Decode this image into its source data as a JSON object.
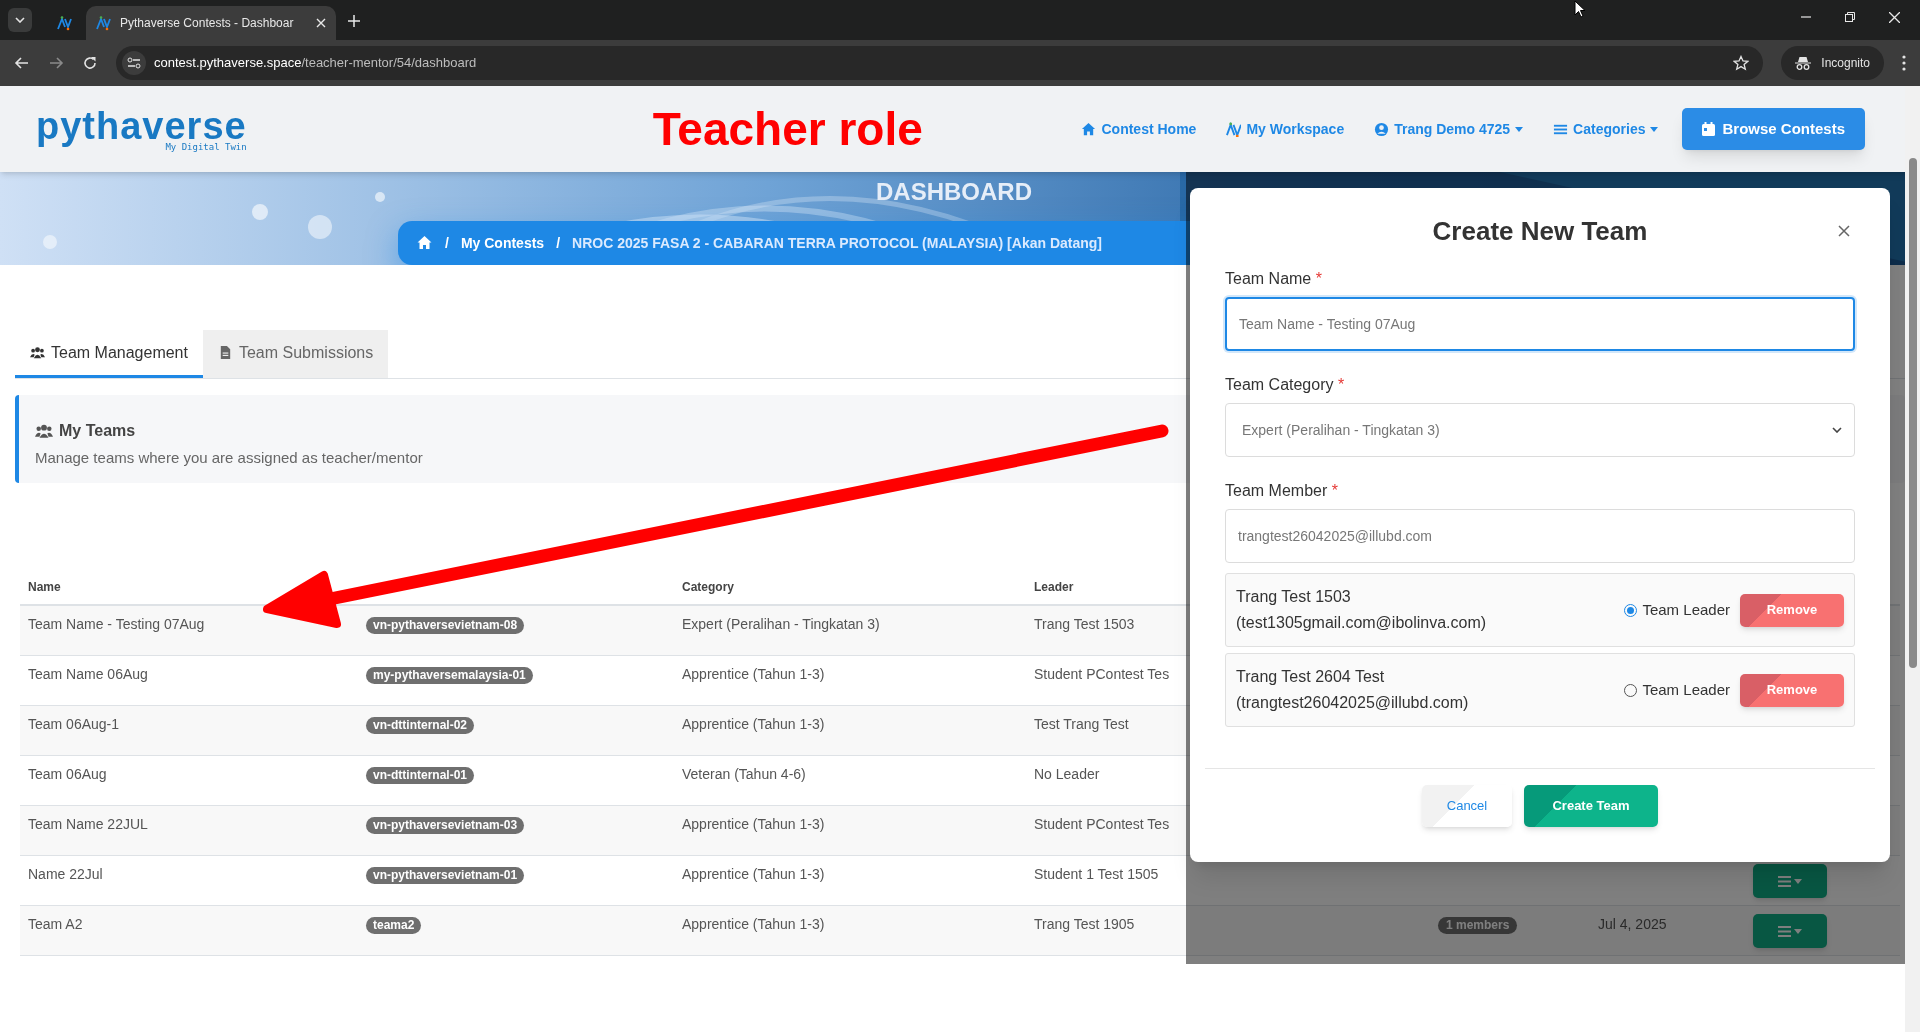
{
  "browser": {
    "tabs": [
      {
        "selected": false
      },
      {
        "title": "Pythaverse Contests - Dashboar",
        "selected": true
      }
    ],
    "url_host": "contest.pythaverse.space",
    "url_path": "/teacher-mentor/54/dashboard",
    "profile": "Incognito"
  },
  "header": {
    "logo": "pythaverse",
    "tagline": "My Digital Twin",
    "annotation": "Teacher role",
    "nav": [
      {
        "label": "Contest Home",
        "dropdown": false
      },
      {
        "label": "My Workspace",
        "dropdown": false
      },
      {
        "label": "Trang Demo 4725",
        "dropdown": true
      },
      {
        "label": "Categories",
        "dropdown": true
      }
    ],
    "cta": "Browse Contests"
  },
  "banner": {
    "title": "DASHBOARD",
    "breadcrumb": [
      {
        "separator": "/",
        "label": "My Contests"
      },
      {
        "separator": "/",
        "label": "NROC 2025 FASA 2 - CABARAN TERRA PROTOCOL (MALAYSIA) [Akan Datang]"
      }
    ]
  },
  "page_tabs": [
    {
      "label": "Team Management",
      "selected": true
    },
    {
      "label": "Team Submissions",
      "selected": false
    }
  ],
  "panel": {
    "title": "My Teams",
    "subtitle": "Manage teams where you are assigned as teacher/mentor"
  },
  "table": {
    "columns": [
      "Name",
      "Category",
      "Leader"
    ],
    "rows": [
      {
        "name": "Team Name - Testing 07Aug",
        "code": "vn-pythaversevietnam-08",
        "category": "Expert (Peralihan - Tingkatan 3)",
        "leader": "Trang Test 1503"
      },
      {
        "name": "Team Name 06Aug",
        "code": "my-pythaversemalaysia-01",
        "category": "Apprentice (Tahun 1-3)",
        "leader": "Student PContest Tes"
      },
      {
        "name": "Team 06Aug-1",
        "code": "vn-dttinternal-02",
        "category": "Apprentice (Tahun 1-3)",
        "leader": "Test Trang Test"
      },
      {
        "name": "Team 06Aug",
        "code": "vn-dttinternal-01",
        "category": "Veteran (Tahun 4-6)",
        "leader": "No Leader"
      },
      {
        "name": "Team Name 22JUL",
        "code": "vn-pythaversevietnam-03",
        "category": "Apprentice (Tahun 1-3)",
        "leader": "Student PContest Tes"
      },
      {
        "name": "Name 22Jul",
        "code": "vn-pythaversevietnam-01",
        "category": "Apprentice (Tahun 1-3)",
        "leader": "Student 1 Test 1505",
        "menu": true
      },
      {
        "name": "Team A2",
        "code": "teama2",
        "category": "Apprentice (Tahun 1-3)",
        "leader": "Trang Test 1905",
        "members": "1 members",
        "created": "Jul 4, 2025",
        "menu": true
      }
    ]
  },
  "modal": {
    "title": "Create New Team",
    "fields": [
      {
        "label": "Team Name",
        "required_mark": "*",
        "kind": "input",
        "value": "Team Name - Testing 07Aug",
        "focused": true
      },
      {
        "label": "Team Category",
        "required_mark": "*",
        "kind": "select",
        "value": "Expert (Peralihan - Tingkatan 3)",
        "focused": false
      },
      {
        "label": "Team Member",
        "required_mark": "*",
        "kind": "input",
        "value": "trangtest26042025@illubd.com",
        "focused": false
      }
    ],
    "members": [
      {
        "name": "Trang Test 1503",
        "email": "(test1305gmail.com@ibolinva.com)",
        "leader_label": "Team Leader",
        "selected": true,
        "remove": "Remove"
      },
      {
        "name": "Trang Test 2604 Test",
        "email": "(trangtest26042025@illubd.com)",
        "leader_label": "Team Leader",
        "selected": false,
        "remove": "Remove"
      }
    ],
    "cancel": "Cancel",
    "submit": "Create Team"
  }
}
